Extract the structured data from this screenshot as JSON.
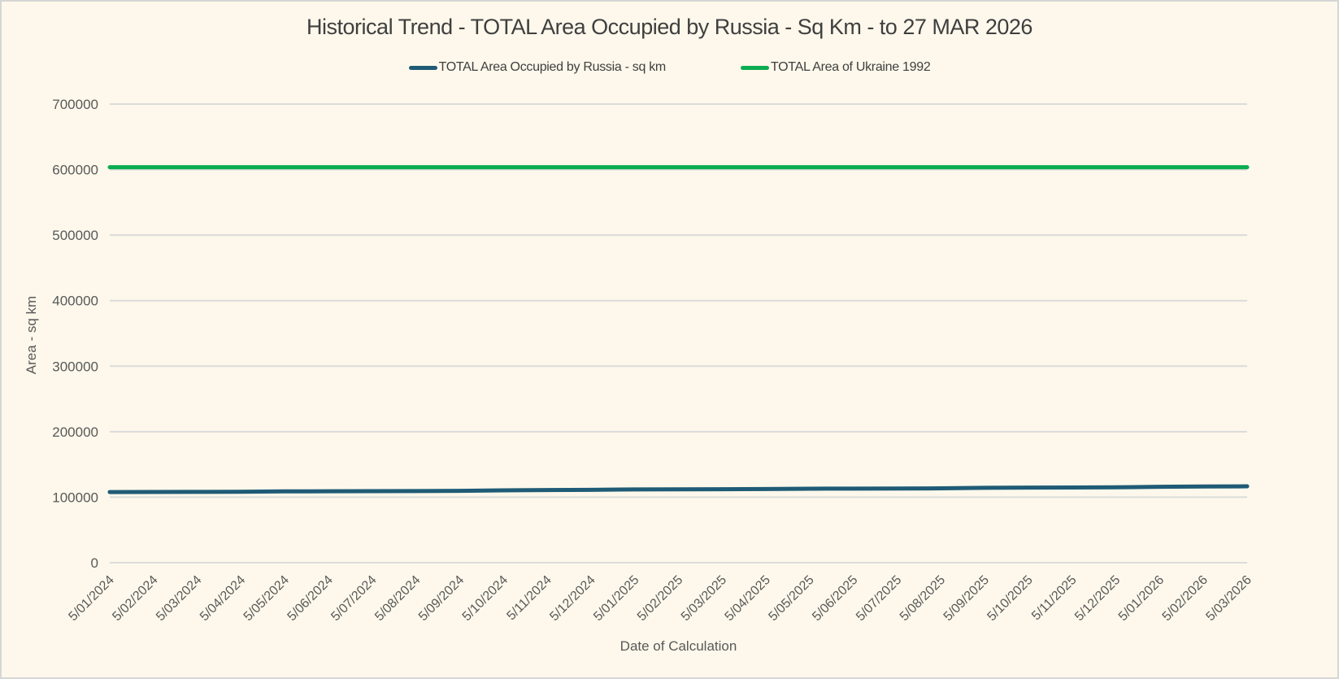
{
  "palette": {
    "background": "#FDF8EB",
    "frame_border": "#D6D6D6",
    "grid": "#DBDBDB",
    "title_text": "#3F3F3F",
    "tick_text": "#595959",
    "series1_color": "#1F5B76",
    "series2_color": "#0BAD51"
  },
  "chart_data": {
    "type": "line",
    "title": "Historical Trend - TOTAL Area Occupied by Russia - Sq Km - to 27 MAR 2026",
    "xlabel": "Date of Calculation",
    "ylabel": "Area - sq km",
    "ylim": [
      0,
      700000
    ],
    "yticks": [
      0,
      100000,
      200000,
      300000,
      400000,
      500000,
      600000,
      700000
    ],
    "grid": true,
    "legend_position": "top-center",
    "x_tick_rotation": -45,
    "x": [
      "5/01/2024",
      "5/02/2024",
      "5/03/2024",
      "5/04/2024",
      "5/05/2024",
      "5/06/2024",
      "5/07/2024",
      "5/08/2024",
      "5/09/2024",
      "5/10/2024",
      "5/11/2024",
      "5/12/2024",
      "5/01/2025",
      "5/02/2025",
      "5/03/2025",
      "5/04/2025",
      "5/05/2025",
      "5/06/2025",
      "5/07/2025",
      "5/08/2025",
      "5/09/2025",
      "5/10/2025",
      "5/11/2025",
      "5/12/2025",
      "5/01/2026",
      "5/02/2026",
      "5/03/2026"
    ],
    "series": [
      {
        "name": "TOTAL Area Occupied by Russia - sq km",
        "color": "#1F5B76",
        "values": [
          107900,
          108000,
          108100,
          108300,
          108900,
          109000,
          109200,
          109400,
          109700,
          110500,
          110900,
          111300,
          111800,
          112000,
          112200,
          112500,
          113000,
          113100,
          113300,
          113500,
          114300,
          114600,
          114800,
          115100,
          115900,
          116400,
          116600
        ]
      },
      {
        "name": "TOTAL Area of Ukraine 1992",
        "color": "#0BAD51",
        "values": [
          603700,
          603700,
          603700,
          603700,
          603700,
          603700,
          603700,
          603700,
          603700,
          603700,
          603700,
          603700,
          603700,
          603700,
          603700,
          603700,
          603700,
          603700,
          603700,
          603700,
          603700,
          603700,
          603700,
          603700,
          603700,
          603700,
          603700
        ]
      }
    ]
  }
}
